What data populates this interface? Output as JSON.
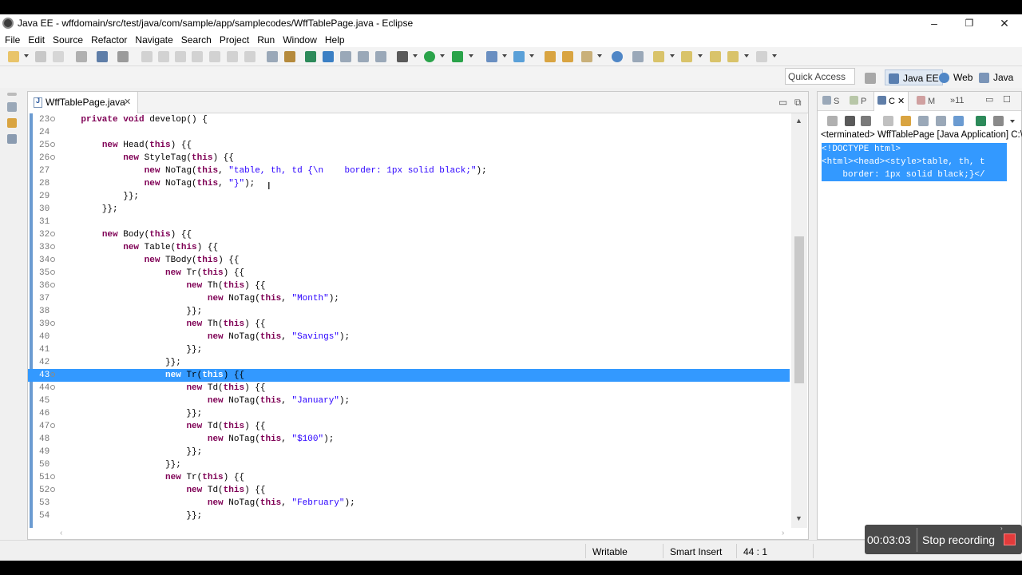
{
  "window": {
    "title": "Java EE - wffdomain/src/test/java/com/sample/app/samplecodes/WffTablePage.java - Eclipse",
    "controls": {
      "minimize": "–",
      "maximize": "❐",
      "close": "✕"
    }
  },
  "menu": [
    "File",
    "Edit",
    "Source",
    "Refactor",
    "Navigate",
    "Search",
    "Project",
    "Run",
    "Window",
    "Help"
  ],
  "toolbar": {
    "icons": [
      "new-icon",
      "save-icon",
      "save-all-icon",
      "print-icon",
      "debug-icon",
      "run-icon",
      "external-tools-icon",
      "search-icon",
      "back-icon",
      "forward-icon"
    ]
  },
  "perspectives": {
    "quick_access_placeholder": "Quick Access",
    "items": [
      "Java EE",
      "Web",
      "Java"
    ]
  },
  "editor": {
    "tab_label": "WffTablePage.java",
    "lines": [
      {
        "num": "23",
        "fold": true,
        "text": "    private void develop() {"
      },
      {
        "num": "24",
        "fold": false,
        "text": ""
      },
      {
        "num": "25",
        "fold": true,
        "text": "        new Head(this) {{"
      },
      {
        "num": "26",
        "fold": true,
        "text": "            new StyleTag(this) {{"
      },
      {
        "num": "27",
        "fold": false,
        "text": "                new NoTag(this, \"table, th, td {\\n    border: 1px solid black;\");"
      },
      {
        "num": "28",
        "fold": false,
        "text": "                new NoTag(this, \"}\");"
      },
      {
        "num": "29",
        "fold": false,
        "text": "            }};"
      },
      {
        "num": "30",
        "fold": false,
        "text": "        }};"
      },
      {
        "num": "31",
        "fold": false,
        "text": ""
      },
      {
        "num": "32",
        "fold": true,
        "text": "        new Body(this) {{"
      },
      {
        "num": "33",
        "fold": true,
        "text": "            new Table(this) {{"
      },
      {
        "num": "34",
        "fold": true,
        "text": "                new TBody(this) {{"
      },
      {
        "num": "35",
        "fold": true,
        "text": "                    new Tr(this) {{"
      },
      {
        "num": "36",
        "fold": true,
        "text": "                        new Th(this) {{"
      },
      {
        "num": "37",
        "fold": false,
        "text": "                            new NoTag(this, \"Month\");"
      },
      {
        "num": "38",
        "fold": false,
        "text": "                        }};"
      },
      {
        "num": "39",
        "fold": true,
        "text": "                        new Th(this) {{"
      },
      {
        "num": "40",
        "fold": false,
        "text": "                            new NoTag(this, \"Savings\");"
      },
      {
        "num": "41",
        "fold": false,
        "text": "                        }};"
      },
      {
        "num": "42",
        "fold": false,
        "text": "                    }};"
      },
      {
        "num": "43",
        "fold": true,
        "text": "                    new Tr(this) {{",
        "highlight": true
      },
      {
        "num": "44",
        "fold": true,
        "text": "                        new Td(this) {{"
      },
      {
        "num": "45",
        "fold": false,
        "text": "                            new NoTag(this, \"January\");"
      },
      {
        "num": "46",
        "fold": false,
        "text": "                        }};"
      },
      {
        "num": "47",
        "fold": true,
        "text": "                        new Td(this) {{"
      },
      {
        "num": "48",
        "fold": false,
        "text": "                            new NoTag(this, \"$100\");"
      },
      {
        "num": "49",
        "fold": false,
        "text": "                        }};"
      },
      {
        "num": "50",
        "fold": false,
        "text": "                    }};"
      },
      {
        "num": "51",
        "fold": true,
        "text": "                    new Tr(this) {{"
      },
      {
        "num": "52",
        "fold": true,
        "text": "                        new Td(this) {{"
      },
      {
        "num": "53",
        "fold": false,
        "text": "                            new NoTag(this, \"February\");"
      },
      {
        "num": "54",
        "fold": false,
        "text": "                        }};"
      }
    ]
  },
  "console": {
    "tabs": [
      "S",
      "P",
      "C",
      "M",
      "»11"
    ],
    "description": "<terminated> WffTablePage [Java Application] C:\\",
    "output": [
      "<!DOCTYPE html>",
      "<html><head><style>table, th, t",
      "    border: 1px solid black;}</"
    ]
  },
  "status": {
    "writable": "Writable",
    "insert_mode": "Smart Insert",
    "position": "44 : 1"
  },
  "recorder": {
    "time": "00:03:03",
    "stop_label": "Stop recording"
  },
  "colors": {
    "selection": "#3399ff",
    "keyword": "#7f0055",
    "string": "#2a00ff",
    "ruler": "#6b9bd1"
  }
}
